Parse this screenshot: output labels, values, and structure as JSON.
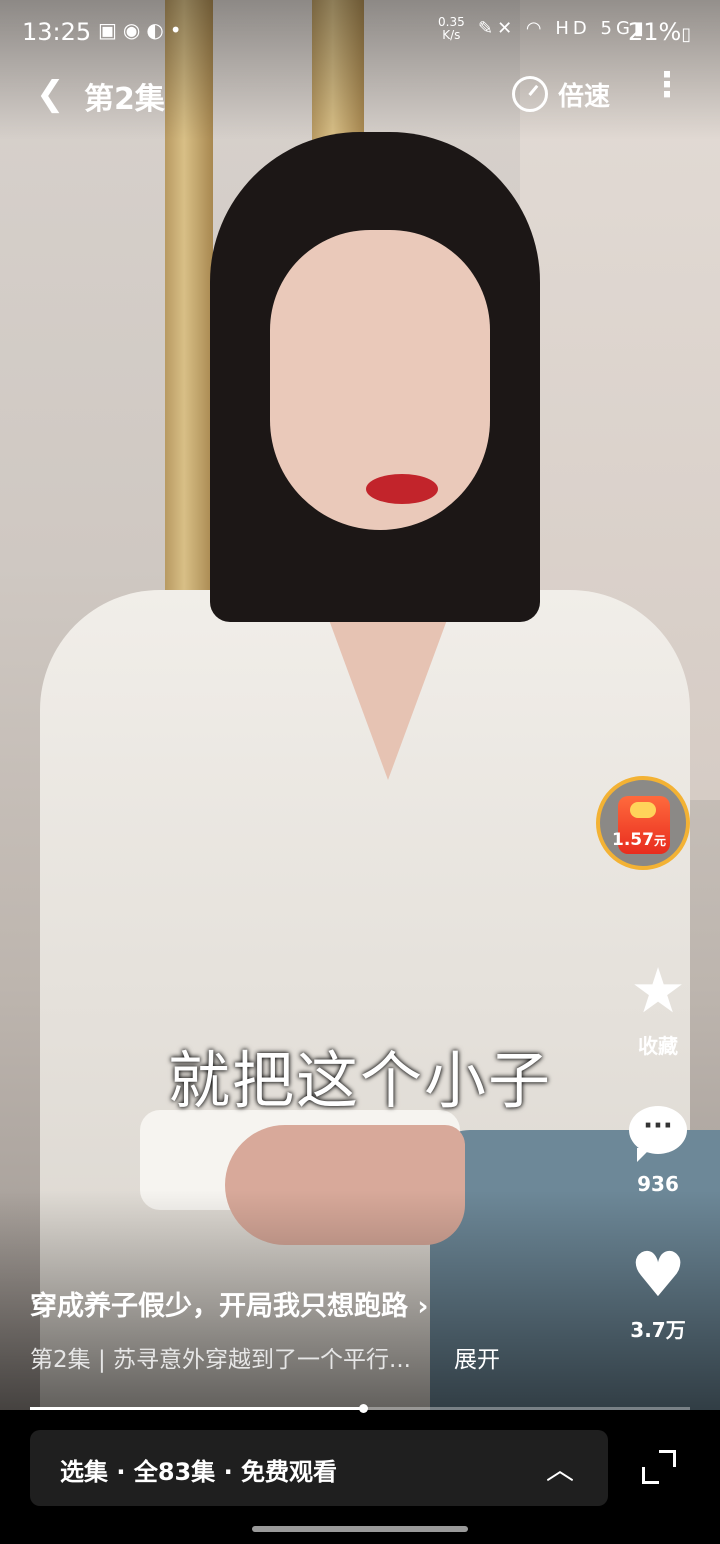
{
  "status_bar": {
    "time": "13:25",
    "net_speed_value": "0.35",
    "net_speed_unit": "K/s",
    "network": "HD",
    "signal": "5G",
    "battery": "21%"
  },
  "top_bar": {
    "title": "第2集",
    "speed_label": "倍速"
  },
  "red_packet": {
    "amount": "1.57",
    "unit": "元"
  },
  "actions": {
    "favorite_label": "收藏",
    "comment_count": "936",
    "like_count": "3.7万"
  },
  "subtitle_text": "就把这个小子",
  "show": {
    "title": "穿成养子假少，开局我只想跑路 ›",
    "description": "第2集 | 苏寻意外穿越到了一个平行...",
    "expand_label": "展开"
  },
  "playback": {
    "progress_fraction": 0.505
  },
  "episode_bar": {
    "label": "选集 · 全83集 · 免费观看"
  },
  "colors": {
    "accent_ring": "#f3b234",
    "red_packet": "#e82c1e"
  }
}
